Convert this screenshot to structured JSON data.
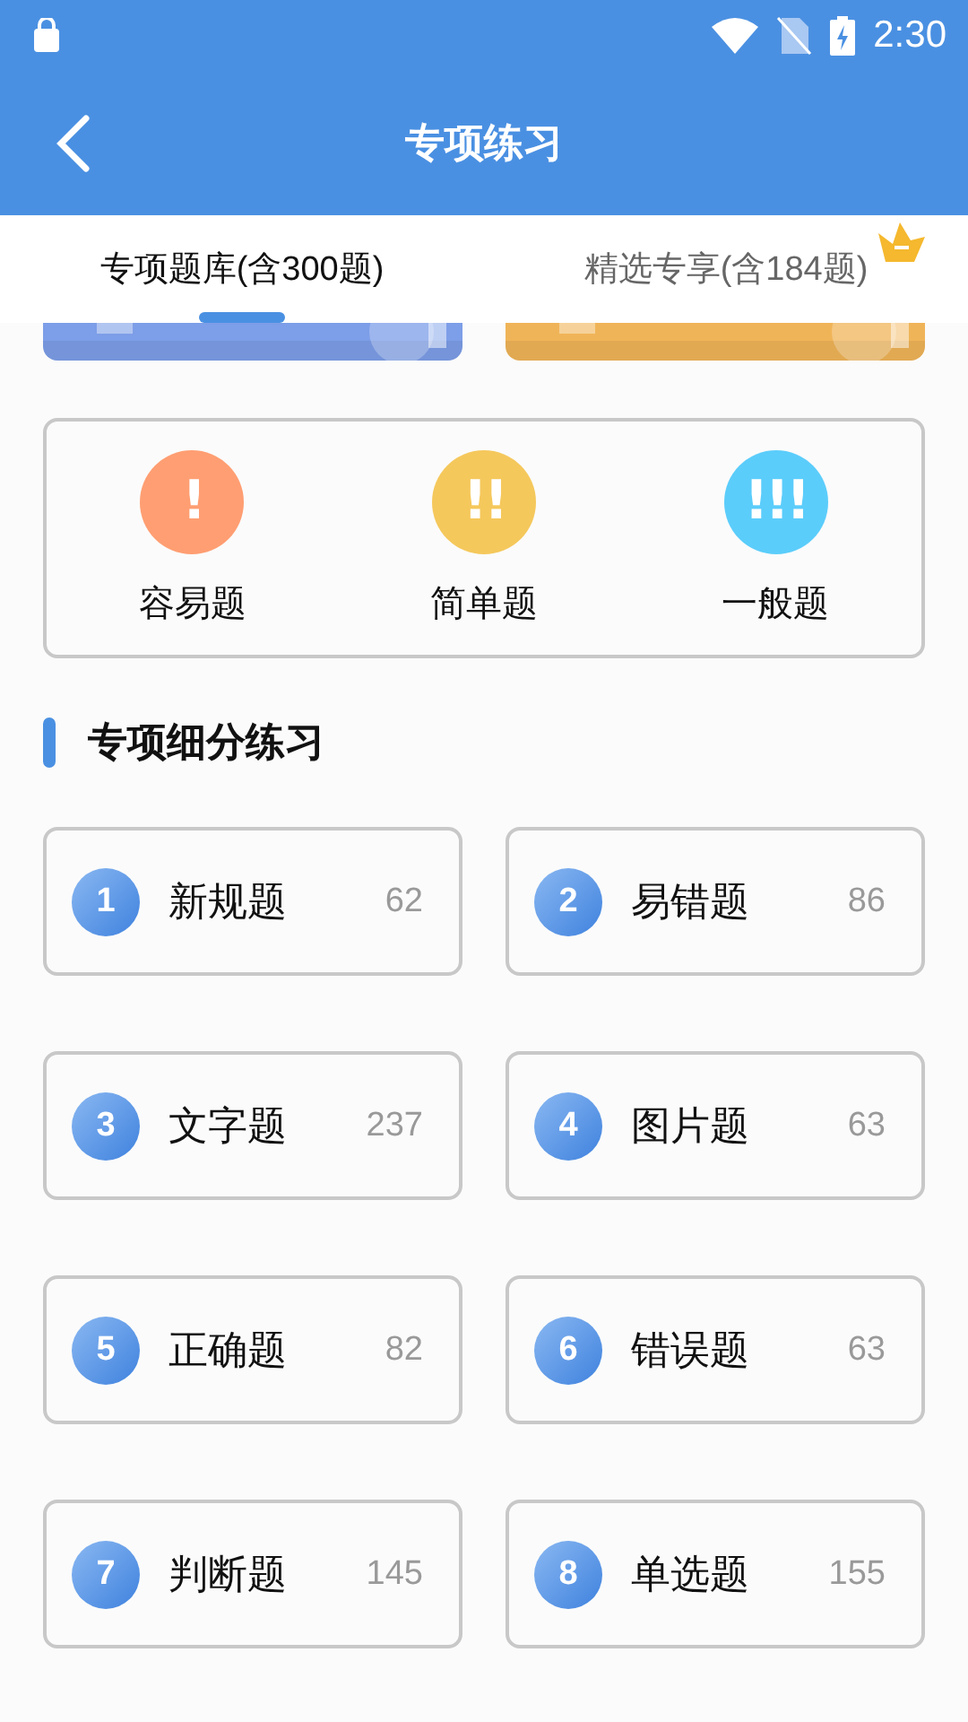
{
  "status_bar": {
    "time": "2:30"
  },
  "app_bar": {
    "title": "专项练习"
  },
  "tabs": [
    {
      "label": "专项题库(含300题)",
      "selected": true,
      "crown": false
    },
    {
      "label": "精选专享(含184题)",
      "selected": false,
      "crown": true
    }
  ],
  "levels": [
    {
      "marks": "!",
      "label": "容易题",
      "color": "#ff9e72"
    },
    {
      "marks": "!!",
      "label": "简单题",
      "color": "#f5c85c"
    },
    {
      "marks": "!!!",
      "label": "一般题",
      "color": "#5bcdfb"
    }
  ],
  "section": {
    "title": "专项细分练习"
  },
  "categories": [
    {
      "number": "1",
      "label": "新规题",
      "count": "62"
    },
    {
      "number": "2",
      "label": "易错题",
      "count": "86"
    },
    {
      "number": "3",
      "label": "文字题",
      "count": "237"
    },
    {
      "number": "4",
      "label": "图片题",
      "count": "63"
    },
    {
      "number": "5",
      "label": "正确题",
      "count": "82"
    },
    {
      "number": "6",
      "label": "错误题",
      "count": "63"
    },
    {
      "number": "7",
      "label": "判断题",
      "count": "145"
    },
    {
      "number": "8",
      "label": "单选题",
      "count": "155"
    }
  ]
}
